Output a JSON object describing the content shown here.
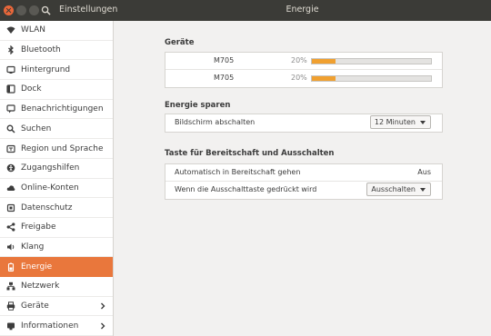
{
  "window": {
    "app_title": "Einstellungen",
    "page_title": "Energie"
  },
  "sidebar": {
    "items": [
      {
        "label": "WLAN",
        "icon": "wifi-icon"
      },
      {
        "label": "Bluetooth",
        "icon": "bluetooth-icon"
      },
      {
        "label": "Hintergrund",
        "icon": "background-icon"
      },
      {
        "label": "Dock",
        "icon": "dock-icon"
      },
      {
        "label": "Benachrichtigungen",
        "icon": "notification-icon"
      },
      {
        "label": "Suchen",
        "icon": "search-icon"
      },
      {
        "label": "Region und Sprache",
        "icon": "region-icon"
      },
      {
        "label": "Zugangshilfen",
        "icon": "accessibility-icon"
      },
      {
        "label": "Online-Konten",
        "icon": "cloud-icon"
      },
      {
        "label": "Datenschutz",
        "icon": "privacy-icon"
      },
      {
        "label": "Freigabe",
        "icon": "share-icon"
      },
      {
        "label": "Klang",
        "icon": "sound-icon"
      },
      {
        "label": "Energie",
        "icon": "battery-icon",
        "active": true
      },
      {
        "label": "Netzwerk",
        "icon": "network-icon"
      },
      {
        "label": "Geräte",
        "icon": "printer-icon",
        "has_submenu": true
      },
      {
        "label": "Informationen",
        "icon": "info-icon",
        "has_submenu": true
      }
    ]
  },
  "devices": {
    "title": "Geräte",
    "items": [
      {
        "name": "M705",
        "percent_label": "20%",
        "level": 0.2
      },
      {
        "name": "M705",
        "percent_label": "20%",
        "level": 0.2
      }
    ]
  },
  "power_saving": {
    "title": "Energie sparen",
    "screen_off_label": "Bildschirm abschalten",
    "screen_off_value": "12 Minuten"
  },
  "suspend": {
    "title": "Taste für Bereitschaft und Ausschalten",
    "auto_suspend_label": "Automatisch in Bereitschaft gehen",
    "auto_suspend_value": "Aus",
    "power_button_label": "Wenn die Ausschalttaste gedrückt wird",
    "power_button_value": "Ausschalten"
  },
  "colors": {
    "accent": "#e9773c",
    "titlebar": "#3b3b37",
    "battery_fill": "#f0a030"
  }
}
